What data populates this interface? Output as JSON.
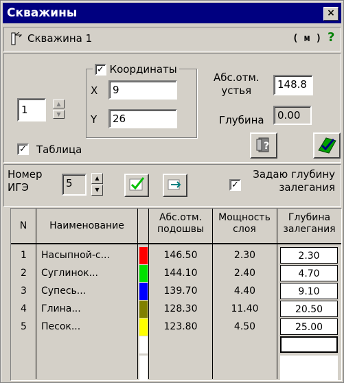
{
  "window": {
    "title": "Скважины",
    "close_glyph": "×"
  },
  "toolbar": {
    "well_name": "Скважина 1",
    "unit_label": "( м )",
    "help_glyph": "?"
  },
  "coords": {
    "index_value": "1",
    "group_label": "Координаты",
    "x_label": "X",
    "x_value": "9",
    "y_label": "Y",
    "y_value": "26"
  },
  "abs_mouth": {
    "label_line1": "Абс.отм.",
    "label_line2": "устья",
    "value": "148.8"
  },
  "depth": {
    "label": "Глубина",
    "value": "0.00"
  },
  "table_toggle": {
    "label": "Таблица"
  },
  "ige": {
    "label_line1": "Номер",
    "label_line2": "ИГЭ",
    "value": "5",
    "set_depth_line1": "Задаю глубину",
    "set_depth_line2": "залегания"
  },
  "table": {
    "headers": {
      "n": "N",
      "name": "Наименование",
      "abs_line1": "Абс.отм.",
      "abs_line2": "подошвы",
      "thick_line1": "Мощность",
      "thick_line2": "слоя",
      "depth_line1": "Глубина",
      "depth_line2": "залегания"
    },
    "rows": [
      {
        "n": "1",
        "name": "Насыпной-с...",
        "color": "#ff0000",
        "abs": "146.50",
        "thick": "2.30",
        "depth": "2.30"
      },
      {
        "n": "2",
        "name": "Суглинок...",
        "color": "#00e000",
        "abs": "144.10",
        "thick": "2.40",
        "depth": "4.70"
      },
      {
        "n": "3",
        "name": "Супесь...",
        "color": "#0000ff",
        "abs": "139.70",
        "thick": "4.40",
        "depth": "9.10"
      },
      {
        "n": "4",
        "name": "Глина...",
        "color": "#808000",
        "abs": "128.30",
        "thick": "11.40",
        "depth": "20.50"
      },
      {
        "n": "5",
        "name": "Песок...",
        "color": "#ffff00",
        "abs": "123.80",
        "thick": "4.50",
        "depth": "25.00"
      }
    ]
  },
  "colors": {
    "titlebar": "#000080",
    "face": "#d4d0c8",
    "help": "#008000"
  }
}
